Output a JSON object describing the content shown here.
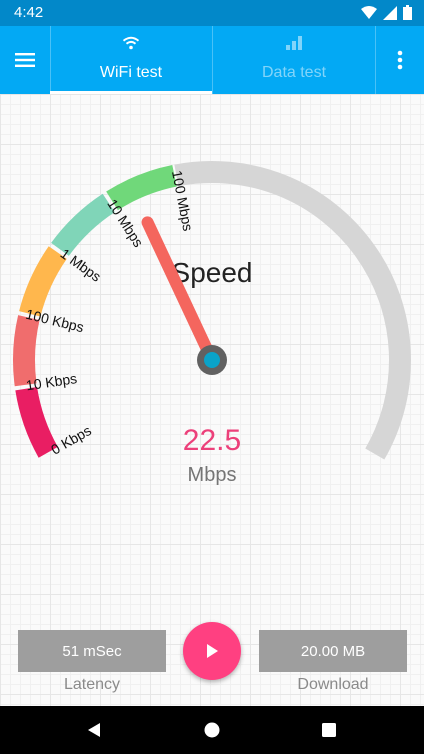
{
  "status_bar": {
    "time": "4:42",
    "icons": [
      "wifi-icon",
      "signal-icon",
      "battery-icon"
    ]
  },
  "tabs": [
    {
      "label": "WiFi test",
      "icon": "wifi-icon",
      "selected": true
    },
    {
      "label": "Data test",
      "icon": "signal-bars-icon",
      "selected": false
    }
  ],
  "gauge": {
    "title": "Speed",
    "value": "22.5",
    "unit": "Mbps",
    "scale_labels": [
      "0 Kbps",
      "10 Kbps",
      "100 Kbps",
      "1 Mbps",
      "10 Mbps",
      "100 Mbps"
    ],
    "segment_colors": [
      "#e91e63",
      "#f06d6d",
      "#ffb74d",
      "#80d5b8",
      "#70d87a"
    ],
    "track_color": "#d6d6d6",
    "needle_color": "#f4665e",
    "value_color": "#ec407a",
    "needle_level_scale_steps": 4.35
  },
  "stats": {
    "latency_value": "51 mSec",
    "latency_label": "Latency",
    "download_value": "20.00 MB",
    "download_label": "Download"
  },
  "colors": {
    "app_bar": "#03a9f4",
    "status_bar": "#0288c9",
    "accent": "#ff4081"
  }
}
